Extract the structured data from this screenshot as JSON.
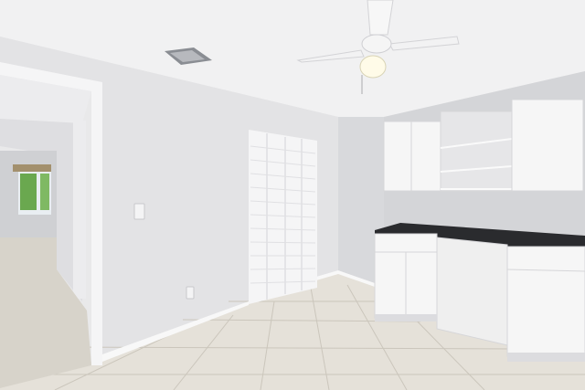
{
  "scene": {
    "description_visible_text": "",
    "colors": {
      "ceiling": "#f2f2f3",
      "wall_left": "#e4e4e6",
      "wall_back": "#d9d9dc",
      "wall_right": "#d2d3d6",
      "floor": "#e6e2da",
      "grout": "#c9c4ba",
      "baseboard": "#f7f7f7",
      "cabinet": "#f6f6f6",
      "cabinet_shadow": "#dcdcdf",
      "countertop": "#2a2b2e",
      "hall_floor": "#d8d4cb",
      "window_green": "#6aa84f",
      "fan_white": "#f4f4f4",
      "fan_light": "#fffbe8",
      "vent": "#8a8d93"
    },
    "icons": [
      "ceiling-fan-icon",
      "air-vent-icon",
      "light-switch-icon",
      "outlet-icon"
    ]
  }
}
